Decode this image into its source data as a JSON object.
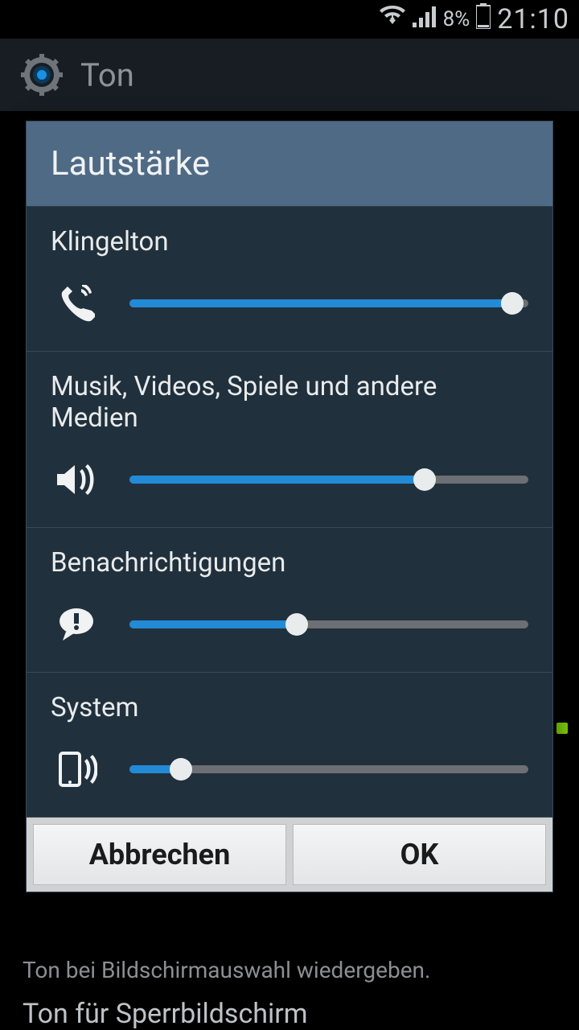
{
  "statusbar": {
    "battery_pct": "8%",
    "time": "21:10"
  },
  "appbar": {
    "title": "Ton"
  },
  "background": {
    "peek_line1": "Ton bei Bildschirmauswahl wiedergeben.",
    "peek_line2": "Ton für Sperrbildschirm"
  },
  "dialog": {
    "title": "Lautstärke",
    "sections": [
      {
        "label": "Klingelton",
        "icon": "phone-ring-icon",
        "value_pct": 96
      },
      {
        "label": "Musik, Videos, Spiele und andere Medien",
        "icon": "speaker-icon",
        "value_pct": 74
      },
      {
        "label": "Benachrichtigungen",
        "icon": "notification-icon",
        "value_pct": 42
      },
      {
        "label": "System",
        "icon": "phone-vibrate-icon",
        "value_pct": 13
      }
    ],
    "buttons": {
      "cancel": "Abbrechen",
      "ok": "OK"
    }
  },
  "colors": {
    "accent": "#238ad6"
  }
}
